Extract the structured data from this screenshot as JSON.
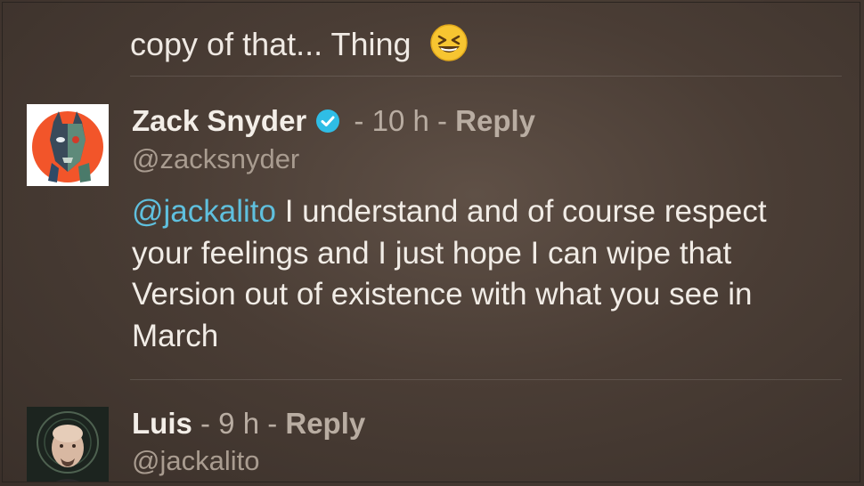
{
  "previous_comment": {
    "partial_line": "copy of that... Thing",
    "emoji": "grinning-squinting-face"
  },
  "comments": [
    {
      "name": "Zack Snyder",
      "verified": true,
      "time": "10 h",
      "reply_label": "Reply",
      "handle": "@zacksnyder",
      "mention": "@jackalito",
      "text": " I understand and of course respect your feelings and I just hope I can wipe that Version out of existence with what you see in March"
    },
    {
      "name": "Luis",
      "verified": false,
      "time": "9 h",
      "reply_label": "Reply",
      "handle": "@jackalito"
    }
  ],
  "colors": {
    "mention": "#5fc0de",
    "verified_badge": "#2fbde6",
    "muted": "#b9ada2"
  }
}
